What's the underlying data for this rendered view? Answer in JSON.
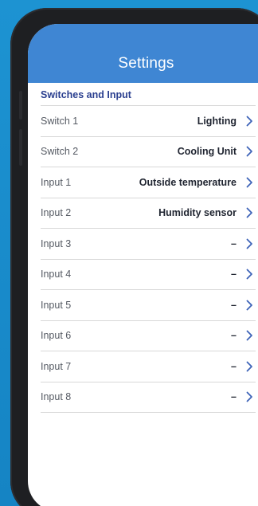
{
  "header": {
    "title": "Settings"
  },
  "section": {
    "title": "Switches and Input"
  },
  "rows": [
    {
      "label": "Switch 1",
      "value": "Lighting"
    },
    {
      "label": "Switch 2",
      "value": "Cooling Unit"
    },
    {
      "label": "Input 1",
      "value": "Outside temperature"
    },
    {
      "label": "Input 2",
      "value": "Humidity sensor"
    },
    {
      "label": "Input 3",
      "value": "–"
    },
    {
      "label": "Input 4",
      "value": "–"
    },
    {
      "label": "Input 5",
      "value": "–"
    },
    {
      "label": "Input 6",
      "value": "–"
    },
    {
      "label": "Input 7",
      "value": "–"
    },
    {
      "label": "Input 8",
      "value": "–"
    }
  ],
  "colors": {
    "header": "#3f86d3",
    "section_title": "#2a3f8f",
    "chevron": "#3d63b8",
    "background": "#1a8ccc"
  },
  "icons": {
    "row_action": "chevron-right-icon"
  }
}
